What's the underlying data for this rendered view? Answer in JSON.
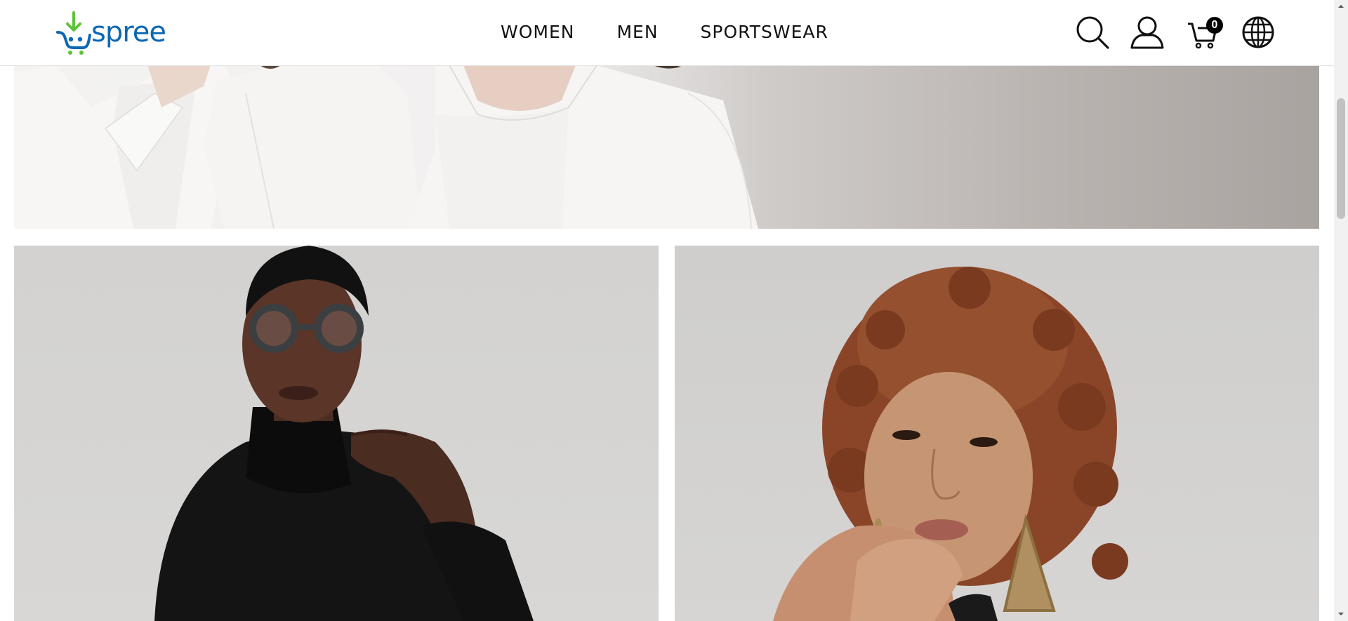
{
  "header": {
    "logo_text": "spree",
    "nav": [
      "WOMEN",
      "MEN",
      "SPORTSWEAR"
    ],
    "icons": [
      "search-icon",
      "account-icon",
      "cart-icon",
      "globe-icon"
    ],
    "cart_count": "0"
  },
  "colors": {
    "brand_blue": "#0d68b3",
    "brand_green": "#5fc23c",
    "text": "#111111"
  },
  "banners": [
    "hero-banner-white-outfits",
    "men-category-tile",
    "women-category-tile"
  ]
}
